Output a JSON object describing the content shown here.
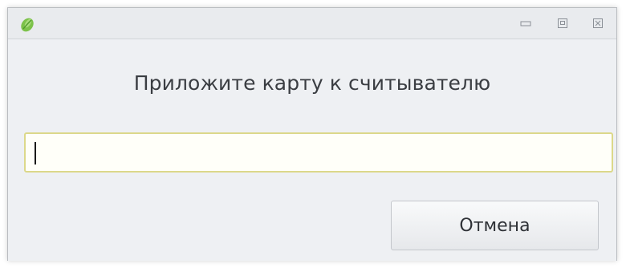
{
  "window": {
    "app_icon": "green-leaf-icon",
    "controls": {
      "minimize_icon": "minimize-icon",
      "maximize_icon": "maximize-icon",
      "close_icon": "close-icon"
    }
  },
  "dialog": {
    "prompt": "Приложите карту к считывателю",
    "card_input": {
      "value": "",
      "placeholder": ""
    },
    "cancel_label": "Отмена"
  },
  "colors": {
    "window_bg": "#eef0f3",
    "input_border": "#dcd88a",
    "input_bg": "#fffff9",
    "icon_green": "#6dbb3c"
  }
}
